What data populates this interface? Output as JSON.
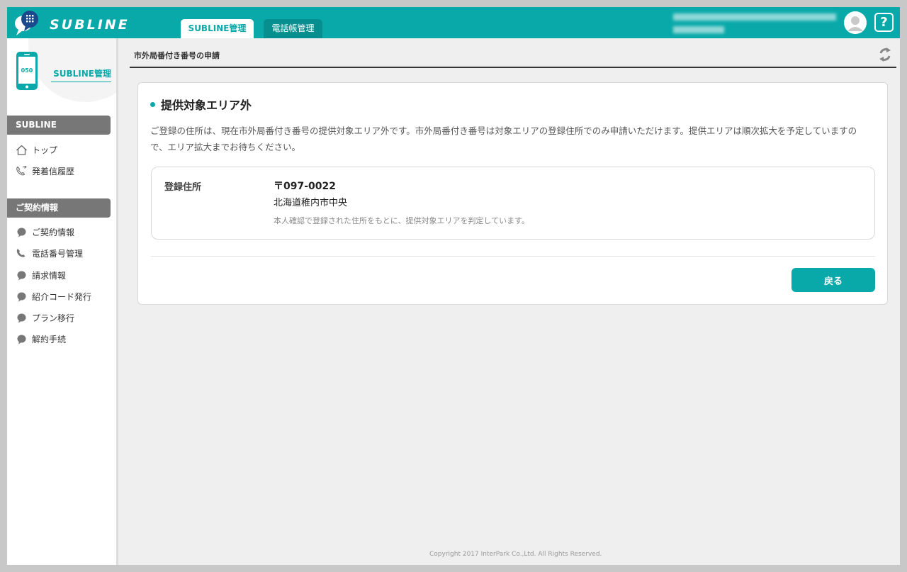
{
  "header": {
    "logo_text": "SUBLINE",
    "tabs": [
      {
        "label": "SUBLINE管理",
        "active": true
      },
      {
        "label": "電話帳管理",
        "active": false
      }
    ],
    "help_label": "?",
    "accent_color": "#0aa9a9"
  },
  "sidebar": {
    "phone_label": "050",
    "title": "SUBLINE管理",
    "sections": [
      {
        "header": "SUBLINE",
        "items": [
          {
            "label": "トップ",
            "icon": "home-icon"
          },
          {
            "label": "発着信履歴",
            "icon": "call-history-icon"
          }
        ]
      },
      {
        "header": "ご契約情報",
        "items": [
          {
            "label": "ご契約情報",
            "icon": "bubble-icon"
          },
          {
            "label": "電話番号管理",
            "icon": "phone-icon"
          },
          {
            "label": "請求情報",
            "icon": "bubble-icon"
          },
          {
            "label": "紹介コード発行",
            "icon": "bubble-icon"
          },
          {
            "label": "プラン移行",
            "icon": "bubble-icon"
          },
          {
            "label": "解約手続",
            "icon": "bubble-icon"
          }
        ]
      }
    ]
  },
  "main": {
    "breadcrumb": "市外局番付き番号の申請",
    "card": {
      "title": "提供対象エリア外",
      "description": "ご登録の住所は、現在市外局番付き番号の提供対象エリア外です。市外局番付き番号は対象エリアの登録住所でのみ申請いただけます。提供エリアは順次拡大を予定していますので、エリア拡大までお待ちください。",
      "address_label": "登録住所",
      "zip": "〒097-0022",
      "address": "北海道稚内市中央",
      "note": "本人確認で登録された住所をもとに、提供対象エリアを判定しています。",
      "back_button": "戻る"
    }
  },
  "footer": {
    "copyright": "Copyright 2017 InterPark Co.,Ltd. All Rights Reserved."
  }
}
